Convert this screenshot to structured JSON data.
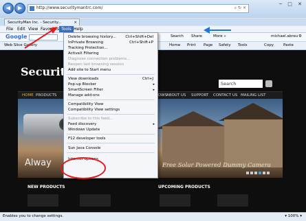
{
  "browser": {
    "address_url": "http://www.securitymantrc.com/",
    "address_tools": "⌕ ↻ ×",
    "tab_title": "SecurityMan Inc. - Security...",
    "tab_close": "×",
    "window_controls": "─ □ ✕",
    "menu": [
      "File",
      "Edit",
      "View",
      "Favorites",
      "Tools",
      "Help"
    ],
    "active_menu": "Tools"
  },
  "google_toolbar": {
    "logo": "Google",
    "search_label": "Search",
    "share_label": "Share",
    "more_label": "More »",
    "user_label": "michael.abreu",
    "settings_label": "⚙"
  },
  "command_bar": {
    "favorites_label": "Web Slice Gallery",
    "home": "Home",
    "print": "Print",
    "page": "Page",
    "safety": "Safety",
    "tools": "Tools",
    "copy": "Copy",
    "paste": "Paste"
  },
  "tools_menu": {
    "items": [
      {
        "label": "Delete browsing history...",
        "shortcut": "Ctrl+Shift+Del"
      },
      {
        "label": "InPrivate Browsing",
        "shortcut": "Ctrl+Shift+P"
      },
      {
        "label": "Tracking Protection...",
        "shortcut": ""
      },
      {
        "label": "ActiveX Filtering",
        "shortcut": ""
      },
      {
        "label": "Diagnose connection problems...",
        "shortcut": "",
        "disabled": true
      },
      {
        "label": "Reopen last browsing session",
        "shortcut": "",
        "disabled": true
      },
      {
        "label": "Add site to Start menu",
        "shortcut": ""
      },
      {
        "label": "View downloads",
        "shortcut": "Ctrl+J"
      },
      {
        "label": "Pop-up Blocker",
        "shortcut": "",
        "submenu": true
      },
      {
        "label": "SmartScreen Filter",
        "shortcut": "",
        "submenu": true
      },
      {
        "label": "Manage add-ons",
        "shortcut": ""
      },
      {
        "label": "Compatibility View",
        "shortcut": ""
      },
      {
        "label": "Compatibility View settings",
        "shortcut": ""
      },
      {
        "label": "Subscribe to this feed...",
        "shortcut": "",
        "disabled": true
      },
      {
        "label": "Feed discovery",
        "shortcut": "",
        "submenu": true
      },
      {
        "label": "Windows Update",
        "shortcut": ""
      },
      {
        "label": "F12 developer tools",
        "shortcut": ""
      },
      {
        "label": "Sun Java Console",
        "shortcut": ""
      },
      {
        "label": "Internet options",
        "shortcut": ""
      }
    ],
    "submenu_arrow": "▸"
  },
  "page": {
    "logo": "Security",
    "search_placeholder": "Search",
    "nav": [
      "HOME",
      "PRODUCTS",
      "TRADE SHOWS",
      "ABOUT US",
      "SUPPORT",
      "CONTACT US",
      "MAILING LIST"
    ],
    "hero_left_text": "Alway",
    "hero_right_text": "Free Solar Powered Dummy Camera",
    "new_products": "NEW PRODUCTS",
    "upcoming_products": "UPCOMING PRODUCTS"
  },
  "status": {
    "text": "Enables you to change settings.",
    "zoom": "▾ 100% ▾"
  },
  "colors": {
    "annotation": "#e51b1b",
    "arrow_blue": "#1e78d8",
    "menu_highlight": "#3a6db5"
  }
}
